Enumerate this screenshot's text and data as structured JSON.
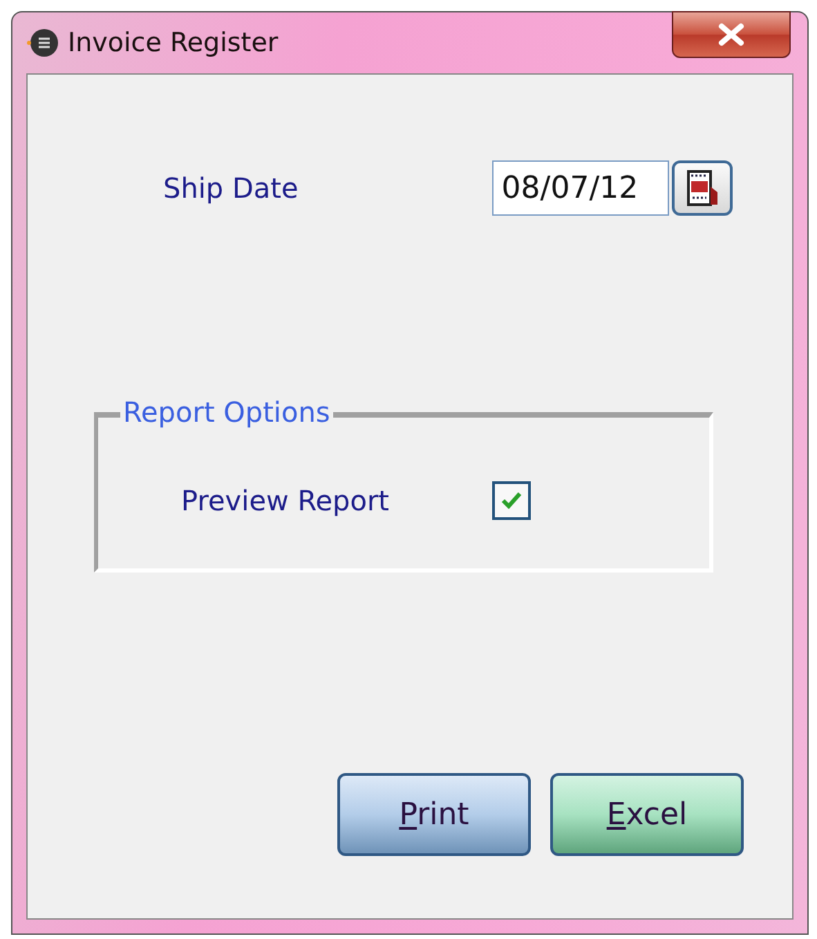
{
  "window": {
    "title": "Invoice Register"
  },
  "ship_date": {
    "label": "Ship Date",
    "value": "08/07/12"
  },
  "report_options": {
    "title": "Report Options",
    "preview_report": {
      "label": "Preview Report",
      "checked": true
    }
  },
  "buttons": [
    {
      "label": "Print",
      "kind": "blue"
    },
    {
      "label": "Excel",
      "kind": "green"
    }
  ]
}
